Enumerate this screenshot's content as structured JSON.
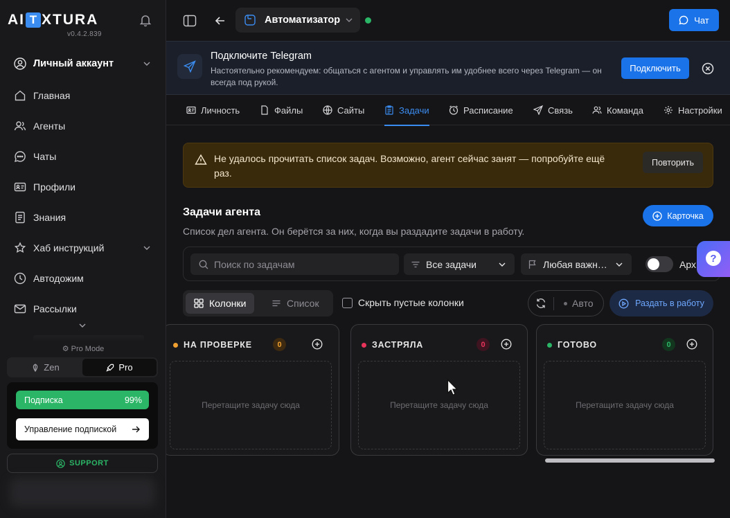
{
  "brand": {
    "logo_left": "AI",
    "logo_box": "T",
    "logo_right": "XTURA",
    "version": "v0.4.2.839"
  },
  "sidebar": {
    "account_label": "Личный аккаунт",
    "items": [
      {
        "label": "Главная",
        "icon": "home-icon"
      },
      {
        "label": "Агенты",
        "icon": "users-icon"
      },
      {
        "label": "Чаты",
        "icon": "chat-icon"
      },
      {
        "label": "Профили",
        "icon": "id-card-icon"
      },
      {
        "label": "Знания",
        "icon": "document-icon"
      },
      {
        "label": "Хаб инструкций",
        "icon": "star-icon"
      },
      {
        "label": "Автодожим",
        "icon": "clock-icon"
      },
      {
        "label": "Рассылки",
        "icon": "mail-icon"
      }
    ],
    "pro_mode_label": "Pro Mode",
    "mode_options": [
      "Zen",
      "Pro"
    ],
    "mode_selected": "Pro",
    "subscription_label": "Подписка",
    "subscription_percent": "99%",
    "manage_subscription": "Управление подпиской",
    "support_label": "SUPPORT"
  },
  "topbar": {
    "agent_name": "Автоматизатор",
    "agent_status_color": "#2bb566",
    "chat_button": "Чат"
  },
  "telegram_banner": {
    "title": "Подключите Telegram",
    "text": "Настоятельно рекомендуем: общаться с агентом и управлять им удобнее всего через Telegram — он всегда под рукой.",
    "connect_button": "Подключить"
  },
  "tabs": [
    {
      "label": "Личность",
      "icon": "id-card-icon"
    },
    {
      "label": "Файлы",
      "icon": "file-icon"
    },
    {
      "label": "Сайты",
      "icon": "globe-icon"
    },
    {
      "label": "Задачи",
      "icon": "clipboard-icon",
      "active": true
    },
    {
      "label": "Расписание",
      "icon": "alarm-icon"
    },
    {
      "label": "Связь",
      "icon": "send-icon"
    },
    {
      "label": "Команда",
      "icon": "team-icon"
    },
    {
      "label": "Настройки",
      "icon": "gear-icon"
    }
  ],
  "warning": {
    "text": "Не удалось прочитать список задач. Возможно, агент сейчас занят — попробуйте ещё раз.",
    "retry_button": "Повторить"
  },
  "tasks": {
    "title": "Задачи агента",
    "description": "Список дел агента. Он берётся за них, когда вы раздадите задачи в работу.",
    "card_button": "Карточка",
    "search_placeholder": "Поиск по задачам",
    "status_filter": "Все задачи",
    "priority_filter": "Любая важн…",
    "archive_label": "Арх",
    "view_columns": "Колонки",
    "view_list": "Список",
    "hide_empty": "Скрыть пустые колонки",
    "auto_label": "Авто",
    "dispatch_button": "Раздать в работу",
    "help_glyph": "?"
  },
  "columns": [
    {
      "title": "НА ПРОВЕРКЕ",
      "count": "0",
      "color": "#f0a030",
      "empty_text": "Перетащите задачу сюда"
    },
    {
      "title": "ЗАСТРЯЛА",
      "count": "0",
      "color": "#e8345a",
      "empty_text": "Перетащите задачу сюда"
    },
    {
      "title": "ГОТОВО",
      "count": "0",
      "color": "#2bb566",
      "empty_text": "Перетащите задачу сюда"
    }
  ]
}
